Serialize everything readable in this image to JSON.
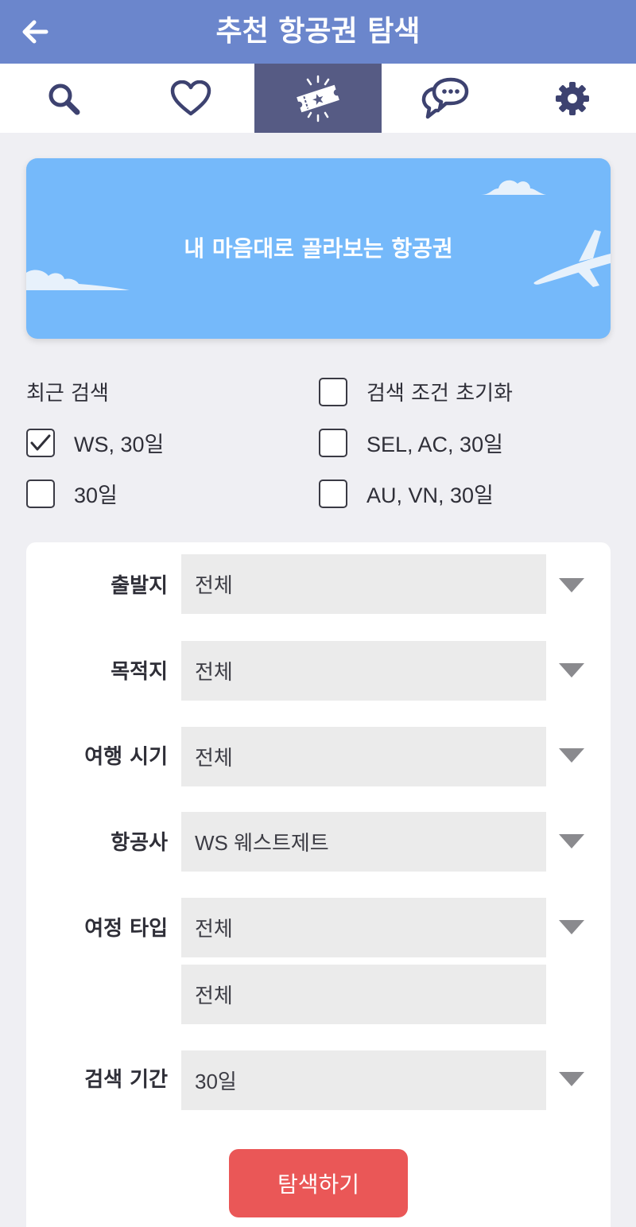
{
  "header": {
    "title": "추천 항공권 탐색",
    "back_icon": "arrow-left-icon",
    "background_color": "#6b86cc"
  },
  "tabs": [
    {
      "icon": "search-icon",
      "active": false
    },
    {
      "icon": "heart-icon",
      "active": false
    },
    {
      "icon": "ticket-icon",
      "active": true
    },
    {
      "icon": "chat-bubbles-icon",
      "active": false
    },
    {
      "icon": "gear-icon",
      "active": false
    }
  ],
  "banner": {
    "title": "내 마음대로 골라보는 항공권",
    "background_color": "#75b9fa"
  },
  "recent": {
    "label": "최근 검색",
    "reset_label": "검색 조건 초기화",
    "items": [
      {
        "label": "WS, 30일",
        "checked": true
      },
      {
        "label": "SEL, AC, 30일",
        "checked": false
      },
      {
        "label": "30일",
        "checked": false
      },
      {
        "label": "AU, VN, 30일",
        "checked": false
      }
    ]
  },
  "form": {
    "departure": {
      "label": "출발지",
      "value": "전체"
    },
    "destination": {
      "label": "목적지",
      "value": "전체"
    },
    "travel_period": {
      "label": "여행 시기",
      "value": "전체"
    },
    "airline": {
      "label": "항공사",
      "value": "WS 웨스트제트"
    },
    "trip_type": {
      "label": "여정 타입",
      "value": "전체",
      "sub_value": "전체"
    },
    "search_range": {
      "label": "검색 기간",
      "value": "30일"
    }
  },
  "search_button": {
    "label": "탐색하기",
    "color": "#ea5757"
  }
}
